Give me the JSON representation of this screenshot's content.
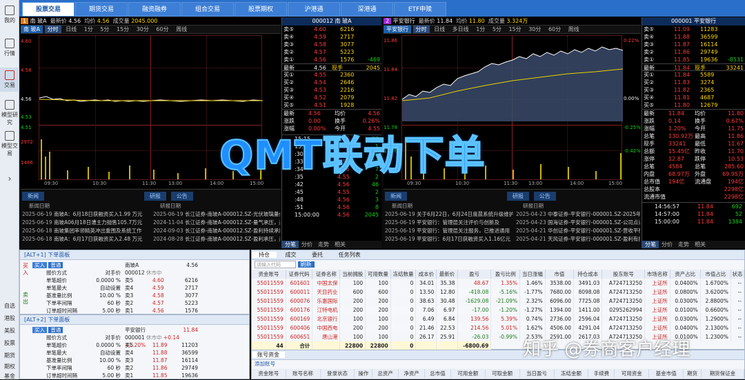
{
  "sidebar": {
    "items": [
      "我的",
      "行情",
      "交易",
      "模型研究",
      "模型交易"
    ],
    "bottom": [
      "自选",
      "港股",
      "美股",
      "股票",
      "期货",
      "期权",
      "基金"
    ]
  },
  "tabs": [
    "股票交易",
    "期货交易",
    "融资融券",
    "组合交易",
    "股票期权",
    "沪港通",
    "深港通",
    "ETF申赎"
  ],
  "panel1": {
    "num": "1",
    "name": "南 玻A",
    "price_label": "最新价",
    "price": "4.56",
    "avg_label": "均价",
    "avg": "4.56",
    "vol_label": "成交量",
    "vol": "2045.000",
    "timeframes": [
      "分时",
      "日线",
      "1分",
      "5分",
      "15分",
      "30分",
      "60分",
      "周线"
    ],
    "y_labels": [
      "4.60",
      "4.58",
      "4.56",
      "4.53",
      "4.51",
      "2972",
      "1486"
    ],
    "x_labels": [
      "09:30",
      "10:30",
      "11:30",
      "13:00",
      "14:00",
      "15:00"
    ]
  },
  "panel2": {
    "num": "2",
    "name": "平安银行",
    "price_label": "最新价",
    "price": "11.84",
    "avg_label": "均价",
    "avg": "11.80",
    "vol_label": "成交量",
    "vol": "3.324万",
    "timeframes": [
      "分时",
      "日线",
      "多日线",
      "1分",
      "5分",
      "15分",
      "30分",
      "60分",
      "周线"
    ],
    "y_labels": [
      "11.86",
      "11.84",
      "11.82",
      "11.78",
      "11.76",
      "0.22%",
      "0.00%",
      "-0.25%",
      "-0.42%"
    ],
    "x_labels": [
      "09:30",
      "10:30",
      "11:30",
      "13:00",
      "14:00",
      "15:00"
    ]
  },
  "ob1": {
    "code": "000012",
    "name": "南 玻A",
    "asks": [
      [
        "卖⑤",
        "4.60",
        "6216"
      ],
      [
        "卖④",
        "4.59",
        "2717"
      ],
      [
        "卖③",
        "4.58",
        "3077"
      ],
      [
        "卖②",
        "4.57",
        "5223"
      ],
      [
        "卖①",
        "4.56",
        "1576",
        "-469"
      ]
    ],
    "last_label": "最新",
    "last": "4.56",
    "cur": "现手",
    "cur_val": "2045",
    "bids": [
      [
        "买①",
        "4.55",
        "2360"
      ],
      [
        "买②",
        "4.54",
        "2646"
      ],
      [
        "买③",
        "4.53",
        "2216"
      ],
      [
        "买④",
        "4.52",
        "2079"
      ],
      [
        "买⑤",
        "4.51",
        "1928"
      ]
    ],
    "stats": [
      [
        "最新",
        "4.56",
        "均价",
        "4.56"
      ],
      [
        "涨跌",
        "0.00",
        "换手",
        "0.26%"
      ],
      [
        "涨幅",
        "0.00%",
        "今开",
        "4.55"
      ]
    ],
    "ticks": [
      [
        "15:15",
        "4.56",
        "20"
      ],
      [
        "15:00",
        "4.56",
        "1"
      ],
      [
        ":30",
        "4.56",
        "35"
      ],
      [
        ":33",
        "4.55",
        "13"
      ],
      [
        ":34",
        "4.56",
        "7"
      ],
      [
        ":35",
        "4.55",
        "2"
      ],
      [
        ":42",
        "4.56",
        "46"
      ],
      [
        ":45",
        "4.55",
        "2"
      ],
      [
        ":48",
        "4.56",
        "3"
      ],
      [
        ":51",
        "4.56",
        "8"
      ],
      [
        "15:00:00",
        "4.56",
        "2045"
      ]
    ],
    "tabs": [
      "分笔",
      "分价",
      "走势",
      "相关"
    ]
  },
  "ob2": {
    "code": "000001",
    "name": "平安银行",
    "asks": [
      [
        "卖⑤",
        "11.09",
        "11283"
      ],
      [
        "卖④",
        "11.88",
        "36599"
      ],
      [
        "卖③",
        "11.87",
        "16114"
      ],
      [
        "卖②",
        "11.86",
        "29749"
      ],
      [
        "卖①",
        "11.85",
        "19636",
        "-8531"
      ]
    ],
    "last_label": "最新",
    "last": "11.84",
    "cur": "现手",
    "cur_val": "33241",
    "bids": [
      [
        "买①",
        "11.84",
        "5589"
      ],
      [
        "买②",
        "11.83",
        "3274"
      ],
      [
        "买③",
        "11.82",
        "2365"
      ],
      [
        "买④",
        "11.81",
        "4687"
      ],
      [
        "买⑤",
        "11.80",
        "12679"
      ]
    ],
    "stats": [
      [
        "最新",
        "11.84",
        "均价",
        "11.80"
      ],
      [
        "涨跌",
        "0.14",
        "换手",
        "0.67%"
      ],
      [
        "涨幅",
        "1.20%",
        "今开",
        "11.75"
      ],
      [
        "总笔",
        "130.92万",
        "最高",
        "11.86"
      ],
      [
        "现手",
        "33241",
        "最低",
        "11.67"
      ],
      [
        "总额",
        "15.45亿",
        "昨收",
        "11.70"
      ],
      [
        "涨停",
        "12.87",
        "跌停",
        "10.53"
      ],
      [
        "总笔",
        "4584",
        "总笔",
        "285.60"
      ],
      [
        "内盘",
        "68.97万",
        "外盘",
        "69.95万"
      ],
      [
        "总市值",
        "194亿",
        "流通盘",
        "194亿"
      ],
      [
        "总股本",
        "",
        "",
        "2298亿"
      ],
      [
        "流通市值",
        "",
        "",
        "2298亿"
      ]
    ],
    "ticks": [
      [
        "14:56:57",
        "11.84",
        "692"
      ],
      [
        "14:57:00",
        "11.84",
        "52"
      ],
      [
        "15:00:00",
        "11.84",
        "1384"
      ]
    ],
    "tabs": [
      "分笔",
      "分价",
      "走势",
      "相关"
    ]
  },
  "news1": {
    "tabs": [
      "新闻",
      "研报",
      "公告"
    ],
    "hdr_left": "新闻日期",
    "hdr_right": "研报日期",
    "left": [
      [
        "2025-06-19",
        "南玻A：6月18日获融资买入1.99 万元"
      ],
      [
        "2025-06-19",
        "南玻A06月18日遭主力抛售105.7万元"
      ],
      [
        "2025-06-18",
        "南玻集团率领精英冲出重围及系统工作"
      ],
      [
        "2025-06-18",
        "南玻A：6月17日获融资买入2.48 万元"
      ]
    ],
    "right": [
      [
        "2025-06-19",
        "长江证券-南玻A-000012.SZ-光伏玻璃量价"
      ],
      [
        "2024-11-04",
        "长江证券-南玻A-000012.SZ-量气承压，盈利"
      ],
      [
        "2024-09-03",
        "长江证券-南玻A-000012.SZ-盈利持续承压"
      ],
      [
        "2024-08-28",
        "长江证券-南玻A-000012.SZ-盈利承压，盈利"
      ]
    ]
  },
  "news2": {
    "tabs": [
      "新闻",
      "研报",
      "公告"
    ],
    "hdr_left": "新闻日期",
    "hdr_right": "研报日期",
    "left": [
      [
        "2025-06-19",
        "关于6月22日，6月24日度晨系统升级维护的"
      ],
      [
        "2025-06-19",
        "平安银行：管理层关注评价与创新及"
      ],
      [
        "2025-06-19",
        "平安银行：管理层关注服务，已推进通用"
      ],
      [
        "2025-06-19",
        "平安银行：6月17日获融资买入1.16亿元"
      ]
    ],
    "right": [
      [
        "2025-04-23",
        "中泰证券-平安银行-000001.SZ-2025年一季"
      ],
      [
        "2025-04-23",
        "国海证券-平安银行-000001.SZ-公司点评"
      ],
      [
        "2025-04-21",
        "华创证券-平安银行-000001.SZ-营收平衡"
      ],
      [
        "2025-04-21",
        "天风证券-平安银行-000001.SZ-盈利有提升"
      ]
    ]
  },
  "watermark": "QMT联动下单",
  "zhihu": "知乎 @券商客户经理",
  "order1": {
    "title": "[ALT+1] 下单面板",
    "tabs": [
      "买入",
      "普通"
    ],
    "side_buy": "买入",
    "side_sell": "卖出",
    "fields": [
      [
        "报价方式",
        "对手价"
      ],
      [
        "单笔超价",
        "0.0000 %"
      ],
      [
        "单笔最大",
        "自动设置"
      ],
      [
        "基准量比例",
        "10.00 %"
      ],
      [
        "下单率间隔",
        "60 秒"
      ],
      [
        "订单超时间隔",
        "5.00 秒"
      ]
    ],
    "stock": "南玻A",
    "price": "4.56",
    "code": "000012",
    "status": "休市中",
    "book": [
      [
        "卖5",
        "4.60",
        "6216"
      ],
      [
        "卖4",
        "4.59",
        "2717"
      ],
      [
        "卖3",
        "4.58",
        "3077"
      ],
      [
        "卖2",
        "4.57",
        "5223"
      ],
      [
        "卖1",
        "4.56",
        "1576"
      ]
    ]
  },
  "order2": {
    "title": "[ALT+2] 下单面板",
    "tabs": [
      "买入",
      "普通"
    ],
    "fields": [
      [
        "报价方式",
        "对手价"
      ],
      [
        "单笔超价",
        "0.0000 %"
      ],
      [
        "单笔最大",
        "自动设置"
      ],
      [
        "基准量比例",
        "10.00 %"
      ],
      [
        "下单率间隔",
        "60 秒"
      ],
      [
        "订单超时间隔",
        "5.00 秒"
      ]
    ],
    "stock": "平安银行",
    "price": "11.84",
    "code": "000001",
    "status": "休市中",
    "change": "+0.14 +1.20%",
    "book": [
      [
        "卖5",
        "11.89",
        "11203"
      ],
      [
        "卖4",
        "11.88",
        "36599"
      ],
      [
        "卖3",
        "11.87",
        "16114"
      ],
      [
        "卖2",
        "11.86",
        "29749"
      ],
      [
        "卖1",
        "11.85",
        "19636"
      ]
    ]
  },
  "positions": {
    "tabs": [
      "持仓",
      "成交",
      "委托",
      "任务列表"
    ],
    "search_placeholder": "请输入代码",
    "refresh": "刷新",
    "cols": [
      "资金账号",
      "证券代码",
      "证券名称",
      "当前拥股",
      "可用数量",
      "冻结数量",
      "成本价",
      "最新价",
      "盈亏",
      "盈亏比例",
      "当日涨幅",
      "市值",
      "持仓成本",
      "股东账号",
      "市场名称",
      "资产占比",
      "市值占比",
      "状态"
    ],
    "rows": [
      [
        "55011559",
        "601601",
        "中国太保",
        "100",
        "100",
        "0",
        "34.01",
        "35.38",
        "48.67",
        "1.35%",
        "1.46%",
        "3538.00",
        "3491.03",
        "A724713250",
        "上证所",
        "0.0400%",
        "1.6700%",
        "--"
      ],
      [
        "55011559",
        "600011",
        "天目药业",
        "600",
        "600",
        "0",
        "13.50",
        "12.80",
        "-418.08",
        "-5.16%",
        "-1.77%",
        "7680.00",
        "8098.08",
        "A724713250",
        "上证所",
        "0.0800%",
        "3.6200%",
        "--"
      ],
      [
        "55011559",
        "600076",
        "乐惠国际",
        "200",
        "200",
        "0",
        "38.63",
        "30.48",
        "-1629.08",
        "-21.09%",
        "2.32%",
        "6096.00",
        "7725.08",
        "A724713250",
        "上证所",
        "0.0300%",
        "2.8800%",
        "--"
      ],
      [
        "55011559",
        "600176",
        "江特电机",
        "200",
        "200",
        "0",
        "7.06",
        "6.97",
        "-17.00",
        "-1.20%",
        "-1.27%",
        "1394.00",
        "1411.00",
        "0295262994",
        "上证所",
        "0.0100%",
        "0.6600%",
        "--"
      ],
      [
        "55011559",
        "600169",
        "北京银行",
        "100",
        "100",
        "0",
        "6.49",
        "6.84",
        "139.56",
        "5.39%",
        "0.74%",
        "2736.00",
        "2596.04",
        "A724713250",
        "上证所",
        "0.0300%",
        "1.2900%",
        "--"
      ],
      [
        "55011559",
        "600406",
        "中国西电",
        "200",
        "200",
        "0",
        "21.46",
        "22.53",
        "214.56",
        "5.01%",
        "1.62%",
        "4506.00",
        "4291.04",
        "A724713250",
        "上证所",
        "0.0400%",
        "2.1300%",
        "--"
      ],
      [
        "55011559",
        "600651",
        "唐山港",
        "100",
        "100",
        "0",
        "26.17",
        "25.91",
        "-26.03",
        "-0.99%",
        "2.53%",
        "2591.00",
        "2617.03",
        "A724713250",
        "上证所",
        "0.0100%",
        "1.2300%",
        "--"
      ]
    ],
    "total": [
      "44",
      "合计",
      "",
      "22800",
      "22800",
      "0",
      "",
      "",
      "-6800.69"
    ]
  },
  "funds": {
    "title": "账号资金",
    "btn": "添加账号",
    "cols": [
      "资金账号",
      "账号名称",
      "登录状态",
      "操作",
      "总资产",
      "净资产",
      "总市值",
      "可用金额",
      "可取金额",
      "当日盈亏",
      "冻结金额",
      "手续费",
      "可用资金",
      "基金市值",
      "期货",
      "期货保证金"
    ]
  }
}
